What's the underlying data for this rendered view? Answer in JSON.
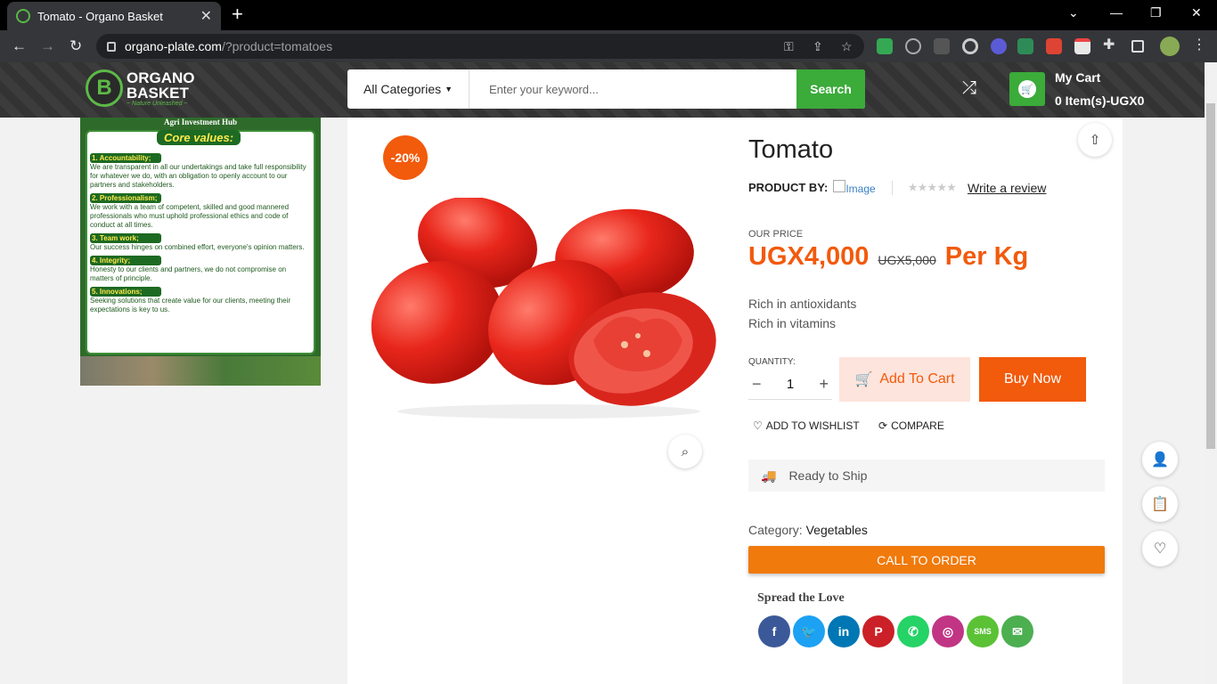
{
  "browser": {
    "tab_title": "Tomato - Organo Basket",
    "url_host": "organo-plate.com",
    "url_path": "/?product=tomatoes"
  },
  "header": {
    "logo_line1": "ORGANO",
    "logo_line2": "BASKET",
    "logo_tagline": "~ Nature Unleashed ~",
    "category_select": "All Categories",
    "search_placeholder": "Enter your keyword...",
    "search_button": "Search",
    "cart_title": "My Cart",
    "cart_summary": "0 Item(s)-UGX0"
  },
  "banner": {
    "top_label": "Agri Investment Hub",
    "heading": "Core values:",
    "values": [
      {
        "title": "1. Accountability;",
        "text": "We are transparent in all our undertakings and take full responsibility for whatever we do, with an obligation to openly account to our partners and stakeholders."
      },
      {
        "title": "2. Professionalism;",
        "text": "We work with a team of competent, skilled and good mannered professionals who must uphold professional ethics and code of conduct at all times."
      },
      {
        "title": "3. Team work;",
        "text": "Our success hinges on combined effort, everyone's opinion matters."
      },
      {
        "title": "4. Integrity;",
        "text": "Honesty to our clients and partners, we do not compromise on matters of principle."
      },
      {
        "title": "5. Innovations;",
        "text": "Seeking solutions that create value for our clients, meeting their expectations is key to us."
      }
    ]
  },
  "product": {
    "discount_badge": "-20%",
    "name": "Tomato",
    "by_label": "PRODUCT BY:",
    "brand_image_alt": "Image",
    "review_link": "Write a review",
    "price_label": "OUR PRICE",
    "price": "UGX4,000",
    "old_price": "UGX5,000",
    "unit": "Per Kg",
    "features": [
      "Rich in antioxidants",
      "Rich in vitamins"
    ],
    "quantity_label": "QUANTITY:",
    "quantity": "1",
    "add_to_cart": "Add To Cart",
    "buy_now": "Buy Now",
    "wishlist": "ADD TO WISHLIST",
    "compare": "COMPARE",
    "shipping": "Ready to Ship",
    "category_label": "Category:",
    "category": "Vegetables",
    "call_to_order": "CALL TO ORDER",
    "spread_title": "Spread the Love"
  },
  "socials": [
    {
      "name": "facebook",
      "glyph": "f",
      "color": "#3b5998"
    },
    {
      "name": "twitter",
      "glyph": "🐦",
      "color": "#1da1f2"
    },
    {
      "name": "linkedin",
      "glyph": "in",
      "color": "#0077b5"
    },
    {
      "name": "pinterest",
      "glyph": "P",
      "color": "#cb2027"
    },
    {
      "name": "whatsapp",
      "glyph": "✆",
      "color": "#25d366"
    },
    {
      "name": "instagram",
      "glyph": "◎",
      "color": "#c13584"
    },
    {
      "name": "sms",
      "glyph": "SMS",
      "color": "#5bc236"
    },
    {
      "name": "email",
      "glyph": "✉",
      "color": "#4caf50"
    }
  ],
  "colors": {
    "brand_green": "#3bab3a",
    "accent_orange": "#f25a0c",
    "call_orange": "#f07a0b"
  }
}
